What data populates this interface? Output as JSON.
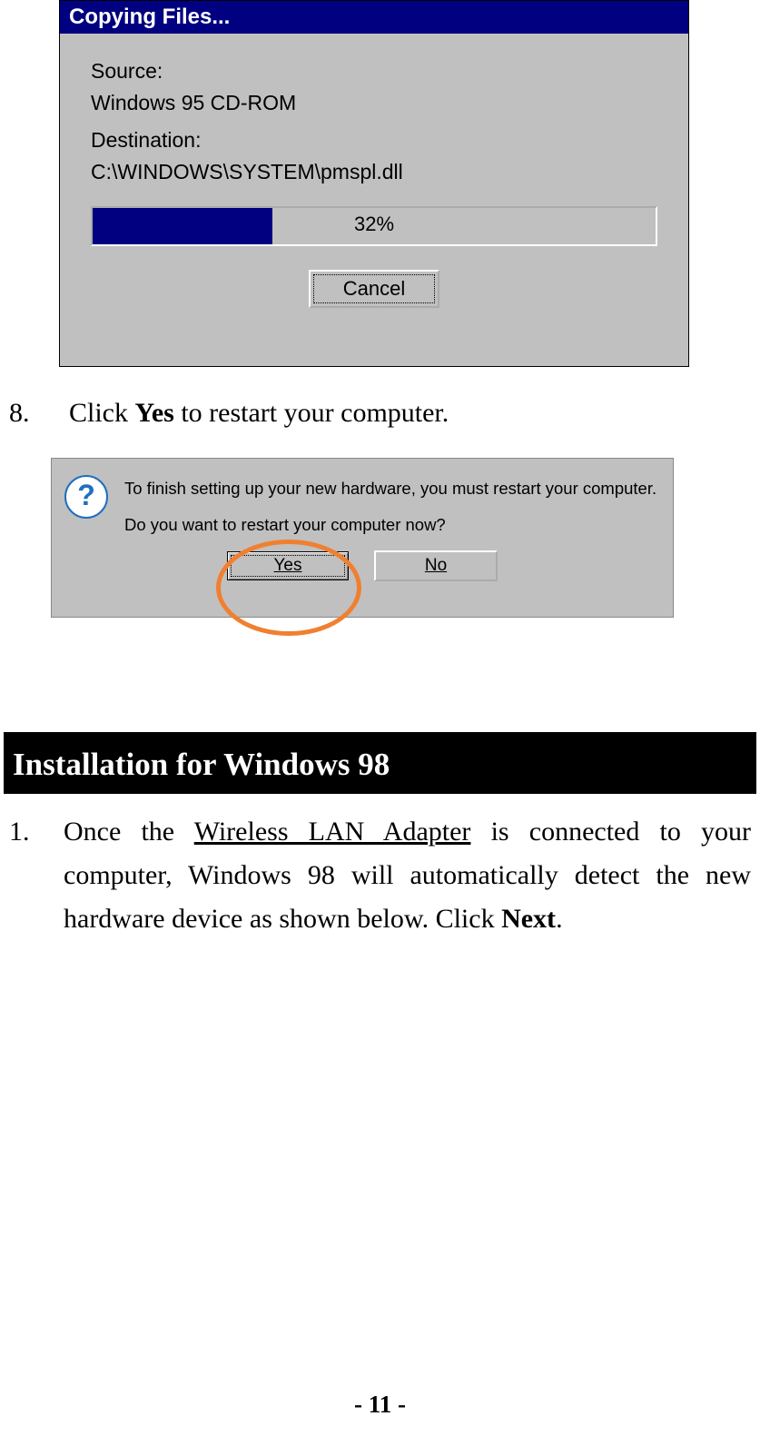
{
  "copy_dialog": {
    "title": "Copying Files...",
    "source_label": "Source:",
    "source_value": "Windows 95 CD-ROM",
    "dest_label": "Destination:",
    "dest_value": "C:\\WINDOWS\\SYSTEM\\pmspl.dll",
    "progress_percent": 32,
    "progress_label": "32%",
    "cancel_label": "Cancel"
  },
  "step8": {
    "number": "8.",
    "pre": "Click ",
    "bold": "Yes",
    "post": " to restart your computer."
  },
  "restart_dialog": {
    "line1": "To finish setting up your new hardware, you must restart your computer.",
    "line2": "Do you want to restart your computer now?",
    "yes_label": "Yes",
    "no_label": "No"
  },
  "section_header": "Installation for Windows 98",
  "step1": {
    "number": "1.",
    "p1a": "Once the ",
    "underlined": "Wireless LAN Adapter",
    "p1b": " is connected to your computer, Windows 98 will automatically detect the new hardware device as shown below.   Click ",
    "bold": "Next",
    "p1c": "."
  },
  "page_number": "- 11 -"
}
